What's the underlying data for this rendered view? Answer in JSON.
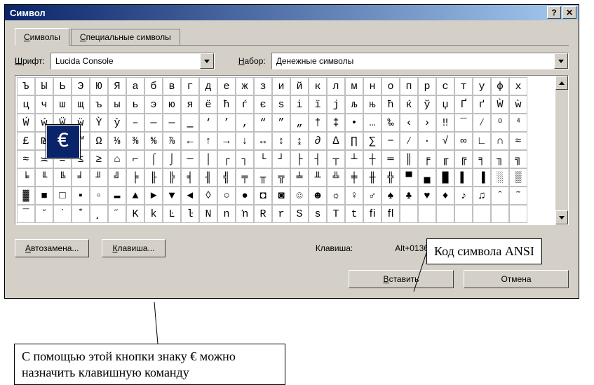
{
  "window": {
    "title": "Символ"
  },
  "tabs": {
    "symbols": "Символы",
    "special": "Специальные символы"
  },
  "font": {
    "label_pre": "Ш",
    "label_rest": "рифт:",
    "value": "Lucida Console"
  },
  "subset": {
    "label_pre": "Н",
    "label_rest": "абор:",
    "value": "Денежные символы"
  },
  "selected_char": "€",
  "grid": [
    [
      "Ъ",
      "Ы",
      "Ь",
      "Э",
      "Ю",
      "Я",
      "а",
      "б",
      "в",
      "г",
      "д",
      "е",
      "ж",
      "з",
      "и",
      "й",
      "к",
      "л",
      "м",
      "н",
      "о",
      "п",
      "р",
      "с",
      "т",
      "у",
      "ф",
      "х"
    ],
    [
      "ц",
      "ч",
      "ш",
      "щ",
      "ъ",
      "ы",
      "ь",
      "э",
      "ю",
      "я",
      "ё",
      "ћ",
      "ѓ",
      "є",
      "ѕ",
      "і",
      "ї",
      "ј",
      "љ",
      "њ",
      "ћ",
      "ќ",
      "ў",
      "џ",
      "Ґ",
      "ґ",
      "Ẁ",
      "ẁ"
    ],
    [
      "Ẃ",
      "ẃ",
      "Ẅ",
      "ẅ",
      "Ỳ",
      "ỳ",
      "–",
      "—",
      "―",
      "‗",
      "‘",
      "’",
      "‚",
      "“",
      "”",
      "„",
      "†",
      "‡",
      "•",
      "…",
      "‰",
      "‹",
      "›",
      "‼",
      "‾",
      "⁄",
      "⁰",
      "⁴"
    ],
    [
      "£",
      "₪",
      "€",
      "™",
      "Ω",
      "⅛",
      "⅜",
      "⅝",
      "⅞",
      "←",
      "↑",
      "→",
      "↓",
      "↔",
      "↕",
      "↨",
      "∂",
      "∆",
      "∏",
      "∑",
      "−",
      "∕",
      "∙",
      "√",
      "∞",
      "∟",
      "∩",
      "≈"
    ],
    [
      "≈",
      "≍",
      "≡",
      "≤",
      "≥",
      "⌂",
      "⌐",
      "⌠",
      "⌡",
      "─",
      "│",
      "┌",
      "┐",
      "└",
      "┘",
      "├",
      "┤",
      "┬",
      "┴",
      "┼",
      "═",
      "║",
      "╒",
      "╓",
      "╔",
      "╕",
      "╖",
      "╗"
    ],
    [
      "╘",
      "╙",
      "╚",
      "╛",
      "╜",
      "╝",
      "╞",
      "╟",
      "╠",
      "╡",
      "╢",
      "╣",
      "╤",
      "╥",
      "╦",
      "╧",
      "╨",
      "╩",
      "╪",
      "╫",
      "╬",
      "▀",
      "▄",
      "█",
      "▌",
      "▐",
      "░",
      "▒"
    ],
    [
      "▓",
      "■",
      "□",
      "▪",
      "▫",
      "▬",
      "▲",
      "►",
      "▼",
      "◄",
      "◊",
      "○",
      "●",
      "◘",
      "◙",
      "☺",
      "☻",
      "☼",
      "♀",
      "♂",
      "♠",
      "♣",
      "♥",
      "♦",
      "♪",
      "♫",
      "ˆ",
      "˜"
    ],
    [
      "¯",
      "˘",
      "˙",
      "˚",
      "¸",
      "˝",
      "K",
      "k",
      "Ŀ",
      "ŀ",
      "N",
      "n",
      "ŉ",
      "R",
      "r",
      "S",
      "s",
      "T",
      "t",
      "ﬁ",
      "ﬂ",
      "",
      "",
      "",
      "",
      "",
      "",
      ""
    ]
  ],
  "buttons": {
    "autocorrect": "Автозамена...",
    "shortcut": "Клавиша...",
    "insert": "Вставить",
    "cancel": "Отмена"
  },
  "shortcut": {
    "label": "Клавиша:",
    "value": "Alt+0136"
  },
  "annotations": {
    "right": "Код символа ANSI",
    "bottom": "С помощью этой кнопки знаку € можно назначить клавишную команду"
  }
}
